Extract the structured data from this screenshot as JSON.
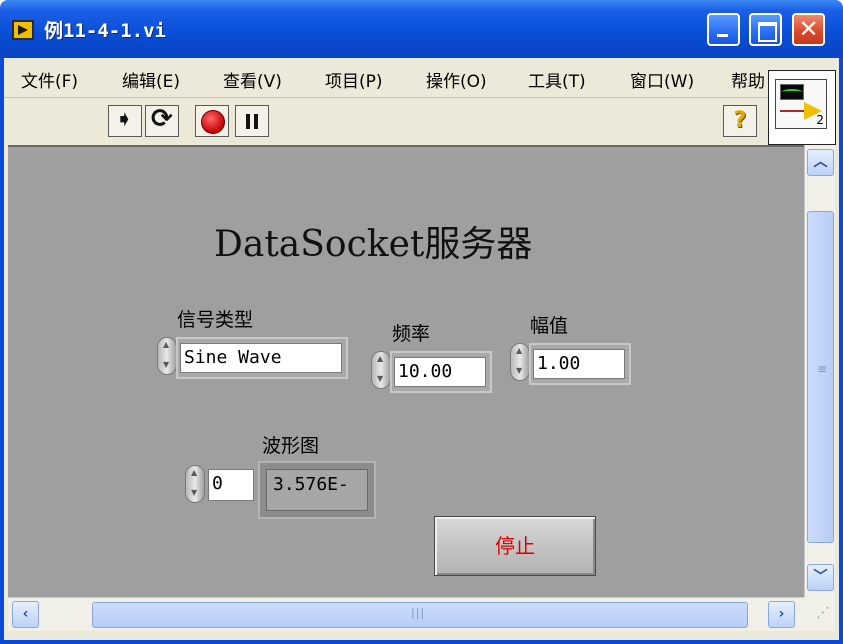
{
  "window": {
    "title": "例11-4-1.vi"
  },
  "menu": [
    {
      "label": "文件(F)"
    },
    {
      "label": "编辑(E)"
    },
    {
      "label": "查看(V)"
    },
    {
      "label": "项目(P)"
    },
    {
      "label": "操作(O)"
    },
    {
      "label": "工具(T)"
    },
    {
      "label": "窗口(W)"
    },
    {
      "label": "帮助"
    }
  ],
  "toolbar": {
    "help_glyph": "?",
    "connector_number": "2"
  },
  "panel": {
    "heading": "DataSocket服务器",
    "signal_type": {
      "label": "信号类型",
      "value": "Sine Wave"
    },
    "frequency": {
      "label": "频率",
      "value": "10.00"
    },
    "amplitude": {
      "label": "幅值",
      "value": "1.00"
    },
    "waveform": {
      "label": "波形图",
      "index": "0",
      "value": "3.576E-"
    },
    "stop_button": {
      "label": "停止"
    }
  },
  "colors": {
    "panel_bg": "#9f9f9f",
    "stop_text": "#e00000",
    "titlebar": "#0a4fd8"
  },
  "icons": [
    "app-vi-icon",
    "minimize-icon",
    "maximize-icon",
    "close-icon",
    "run-icon",
    "run-continuously-icon",
    "abort-icon",
    "pause-icon",
    "help-icon",
    "connector-pane-icon",
    "scroll-up-icon",
    "scroll-down-icon",
    "scroll-left-icon",
    "scroll-right-icon",
    "resize-grip-icon"
  ]
}
